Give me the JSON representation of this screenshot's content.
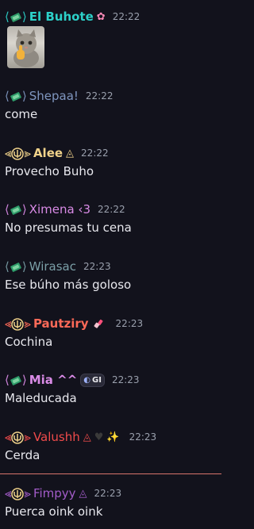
{
  "colors": {
    "background": "#12121c",
    "time": "#9aa0ad",
    "cyan": "#2cd0c8",
    "slate": "#7f96bf",
    "gold": "#f0d28a",
    "pink": "#d98be6",
    "teal": "#7b9fa7",
    "coral": "#ff6a58",
    "red": "#f04b4b",
    "purple": "#a35cc9",
    "divider": "#d8746b"
  },
  "messages": [
    {
      "author": "El Buhote",
      "time": "22:22",
      "body": "",
      "badge": "ticket",
      "attachment": "cat-image",
      "deco": "flower"
    },
    {
      "author": "Shepaa!",
      "time": "22:22",
      "body": "come",
      "badge": "ticket"
    },
    {
      "author": "Alee",
      "time": "22:22",
      "body": "Provecho Buho",
      "badge": "trident",
      "deco": "triangle"
    },
    {
      "author": "Ximena ‹3",
      "time": "22:22",
      "body": "No presumas tu cena",
      "badge": "ticket"
    },
    {
      "author": "Wirasac",
      "time": "22:23",
      "body": "Ese búho más goloso",
      "badge": "ticket"
    },
    {
      "author": "Pautziry",
      "time": "22:23",
      "body": "Cochina",
      "badge": "trident",
      "deco": "lipstick"
    },
    {
      "author": "Mia ^^",
      "time": "22:23",
      "body": "Maleducada",
      "badge": "ticket",
      "tag": "GI"
    },
    {
      "author": "Valushh",
      "time": "22:23",
      "body": "Cerda",
      "badge": "trident",
      "deco": "triangle-heart-sparkle"
    },
    {
      "author": "Fimpyy",
      "time": "22:23",
      "body": "Puerca oink oink",
      "badge": "trident",
      "deco": "triangle"
    }
  ]
}
